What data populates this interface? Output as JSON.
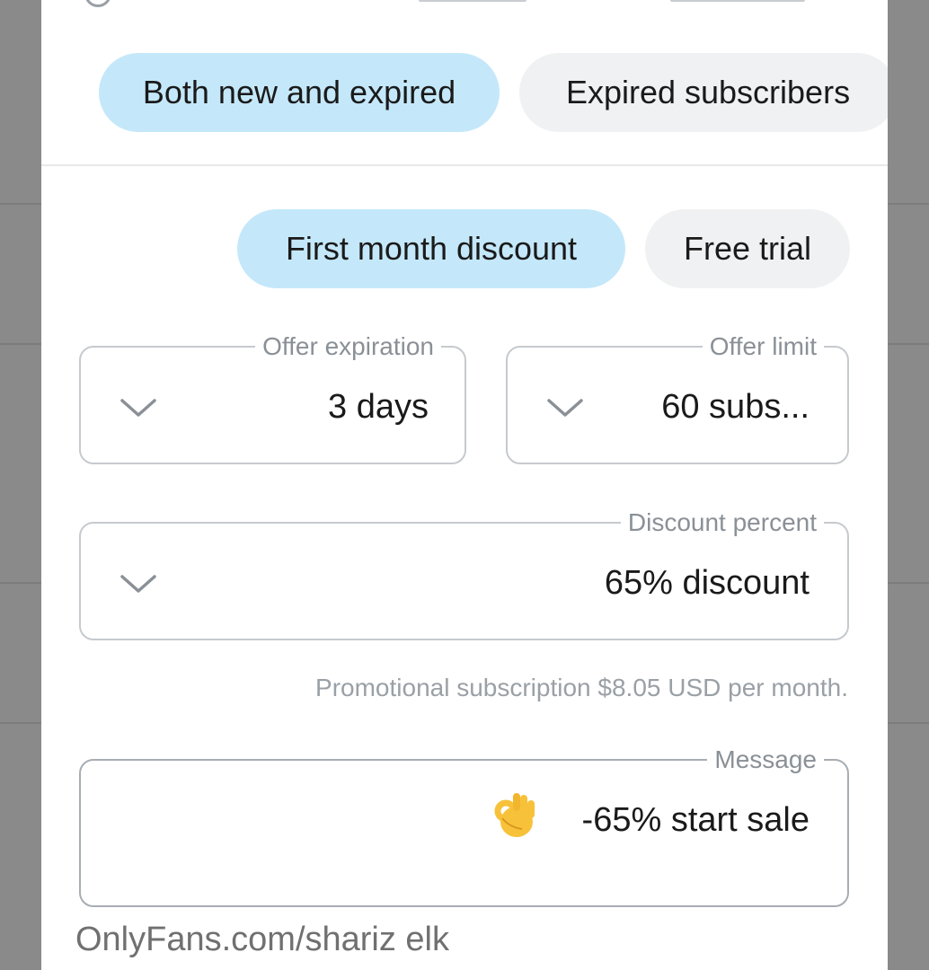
{
  "audience": {
    "options": [
      {
        "label": "Both new and expired",
        "selected": true
      },
      {
        "label": "Expired subscribers",
        "selected": false
      }
    ]
  },
  "offer_type": {
    "options": [
      {
        "label": "First month discount",
        "selected": true
      },
      {
        "label": "Free trial",
        "selected": false
      }
    ]
  },
  "offer_expiration": {
    "legend": "Offer expiration",
    "value": "3 days"
  },
  "offer_limit": {
    "legend": "Offer limit",
    "value": "60 subs..."
  },
  "discount_percent": {
    "legend": "Discount percent",
    "value": "65% discount"
  },
  "helper_text": "Promotional subscription $8.05 USD per month.",
  "message": {
    "legend": "Message",
    "value": "-65% start sale",
    "emoji": "ok-hand-emoji"
  },
  "watermark": "OnlyFans.com/shariz elk",
  "colors": {
    "selected_chip": "#c4e8fa",
    "unselected_chip": "#f0f1f2",
    "field_border": "#c6cace",
    "muted_text": "#9aa0a6"
  }
}
